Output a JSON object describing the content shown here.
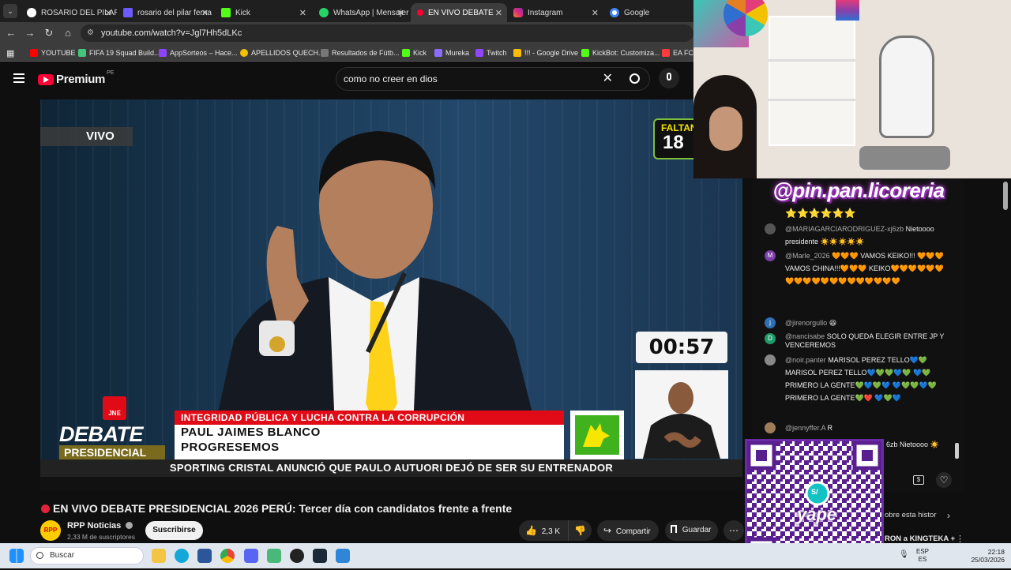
{
  "browser": {
    "tabs": [
      {
        "title": "ROSARIO DEL PILAR",
        "color": "#ffffff"
      },
      {
        "title": "rosario del pilar ferna",
        "color": "#6b5cff"
      },
      {
        "title": "Kick",
        "color": "#53fc18"
      },
      {
        "title": "WhatsApp | Mensajer",
        "color": "#25d366"
      },
      {
        "title": "EN VIVO DEBATE",
        "color": "#ff0033"
      },
      {
        "title": "Instagram",
        "color": "#e1306c"
      },
      {
        "title": "Google",
        "color": "#4285f4"
      }
    ],
    "url": "youtube.com/watch?v=Jgl7Hh5dLKc",
    "bookmarks": [
      {
        "label": "YOUTUBE",
        "color": "#ff0000"
      },
      {
        "label": "FIFA 19 Squad Build...",
        "color": "#42c77b"
      },
      {
        "label": "AppSorteos – Hace...",
        "color": "#8e44ff"
      },
      {
        "label": "APELLIDOS QUECH...",
        "color": "#f2c200"
      },
      {
        "label": "Resultados de Fútb...",
        "color": "#777777"
      },
      {
        "label": "Kick",
        "color": "#53fc18"
      },
      {
        "label": "Mureka",
        "color": "#8a6cff"
      },
      {
        "label": "Twitch",
        "color": "#9146ff"
      },
      {
        "label": "!!! - Google Drive",
        "color": "#fbbc04"
      },
      {
        "label": "KickBot: Customiza...",
        "color": "#53fc18"
      },
      {
        "label": "EA FC 2",
        "color": "#ff3b3b"
      }
    ]
  },
  "youtube": {
    "logo_text": "Premium",
    "region": "PE",
    "search_query": "como no creer en dios",
    "video": {
      "live_badge": "VIVO",
      "faltan_label": "FALTAN",
      "faltan_days": "18",
      "timer": "00:57",
      "debate_line1": "DEBATE",
      "debate_line2": "PRESIDENCIAL",
      "jne": "JNE",
      "topic": "INTEGRIDAD PÚBLICA Y LUCHA CONTRA LA CORRUPCIÓN",
      "candidate": "PAUL JAIMES BLANCO",
      "party": "PROGRESEMOS",
      "ticker": "SPORTING CRISTAL ANUNCIÓ QUE PAULO AUTUORI DEJÓ DE SER SU ENTRENADOR"
    },
    "title": "EN VIVO DEBATE PRESIDENCIAL 2026 PERÚ: Tercer día con candidatos frente a frente",
    "channel": {
      "name": "RPP Noticias",
      "subs": "2,33 M de suscriptores",
      "avatar": "RPP"
    },
    "subscribe": "Suscribirse",
    "likes": "2,3 K",
    "share": "Compartir",
    "save": "Guardar"
  },
  "overlay": {
    "handle": "@pin.pan.licoreria",
    "qr_brand": "yape",
    "qr_symbol": "S/",
    "under_qr_1": "obre esta histor",
    "under_qr_2": "RON a KINGTEKA +"
  },
  "chat": {
    "top_stars": "⭐⭐⭐⭐⭐⭐",
    "messages": [
      {
        "user": "@MARIAGARCIARODRIGUEZ-xj6zb",
        "text": "Nietoooo presidente ☀️☀️☀️☀️☀️",
        "avatar": "",
        "color": "#555555"
      },
      {
        "user": "@Marle_2026",
        "text": "🧡🧡🧡 VAMOS KEIKO!!! 🧡🧡🧡VAMOS CHINA!!!🧡🧡🧡 KEIKO🧡🧡🧡🧡🧡🧡🧡🧡🧡🧡🧡🧡🧡🧡🧡🧡🧡🧡🧡",
        "avatar": "M",
        "color": "#7b3fa8"
      },
      {
        "user": "@jirenorgullo",
        "text": "😆",
        "avatar": "j",
        "color": "#2f6fb3"
      },
      {
        "user": "@nancisabe",
        "text": "SOLO QUEDA ELEGIR ENTRE JP Y VENCEREMOS",
        "avatar": "D",
        "color": "#1f9b6a"
      },
      {
        "user": "@noir.panter",
        "text": "MARISOL PEREZ TELLO💙💚 MARISOL PEREZ TELLO💙💚💚💙💚 💙💚PRIMERO LA GENTE💚💙💚💙 💙💚💚💙💚PRIMERO LA GENTE💚❤️ 💙💚💙",
        "avatar": "",
        "color": "#888888"
      },
      {
        "user": "@jennyffer.A",
        "text": "R",
        "avatar": "",
        "color": "#a07d5a"
      },
      {
        "user": "",
        "text": "6zb Nietoooo ☀️",
        "avatar": "",
        "color": "#444444"
      }
    ]
  },
  "taskbar": {
    "search_placeholder": "Buscar",
    "lang1": "ESP",
    "lang2": "ES",
    "time": "22:18",
    "date": "25/03/2026"
  }
}
